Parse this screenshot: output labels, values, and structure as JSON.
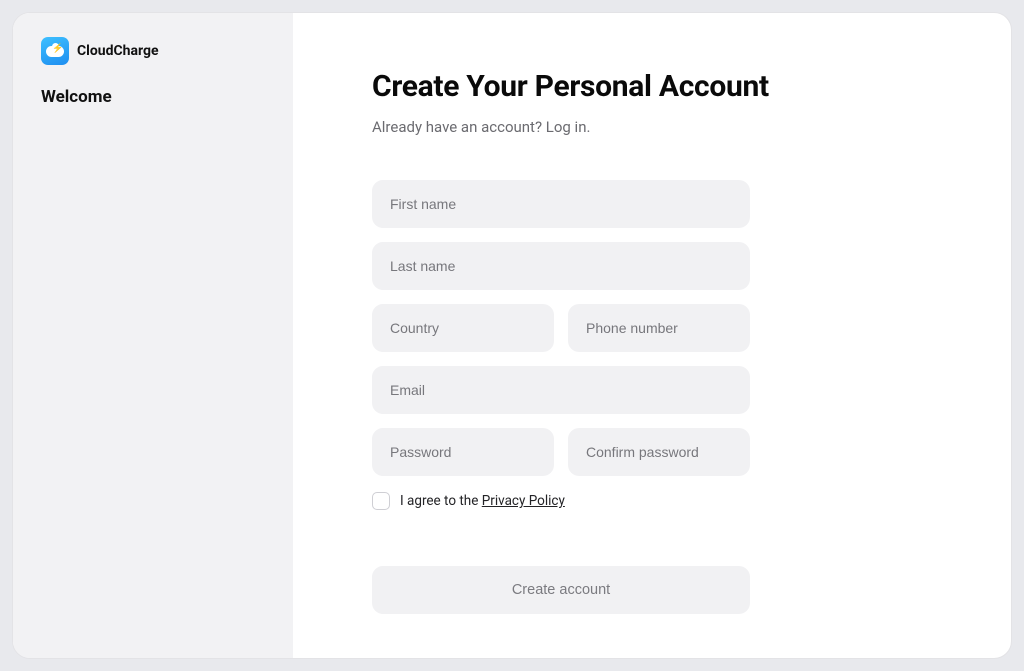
{
  "brand": {
    "name": "CloudCharge"
  },
  "sidebar": {
    "title": "Welcome"
  },
  "page": {
    "title": "Create Your Personal Account",
    "already_text": "Already have an account? ",
    "login_text": "Log in."
  },
  "form": {
    "first_name": {
      "placeholder": "First name",
      "value": ""
    },
    "last_name": {
      "placeholder": "Last name",
      "value": ""
    },
    "country": {
      "placeholder": "Country",
      "value": ""
    },
    "phone": {
      "placeholder": "Phone number",
      "value": ""
    },
    "email": {
      "placeholder": "Email",
      "value": ""
    },
    "password": {
      "placeholder": "Password",
      "value": ""
    },
    "confirm_password": {
      "placeholder": "Confirm password",
      "value": ""
    },
    "consent_prefix": "I agree to the ",
    "consent_link": "Privacy Policy",
    "submit_label": "Create account"
  }
}
